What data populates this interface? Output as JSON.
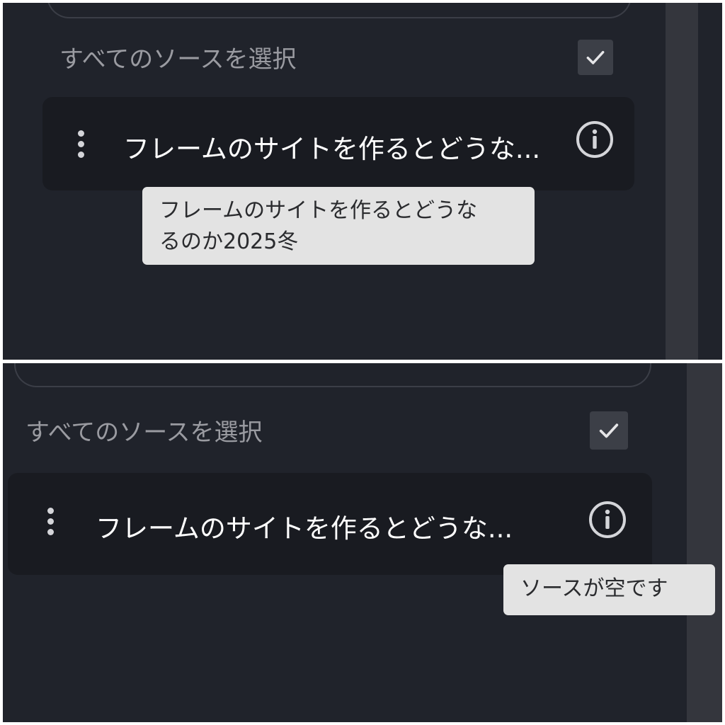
{
  "frames": [
    {
      "select_all_label": "すべてのソースを選択",
      "source_title": "フレームのサイトを作るとどうな...",
      "tooltip": "フレームのサイトを作るとどうな\nるのか2025冬"
    },
    {
      "select_all_label": "すべてのソースを選択",
      "source_title": "フレームのサイトを作るとどうな...",
      "tooltip": "ソースが空です"
    }
  ],
  "icons": {
    "checkbox": "check-icon",
    "menu": "more-vert-icon",
    "info": "info-icon"
  },
  "colors": {
    "background": "#20232b",
    "row_background": "#191b21",
    "checkbox_fill": "#3c3f47",
    "muted_text": "#9a9ba1",
    "tooltip_background": "#e3e3e3",
    "scrollbar": "#34363d"
  },
  "checkbox_checked": true
}
